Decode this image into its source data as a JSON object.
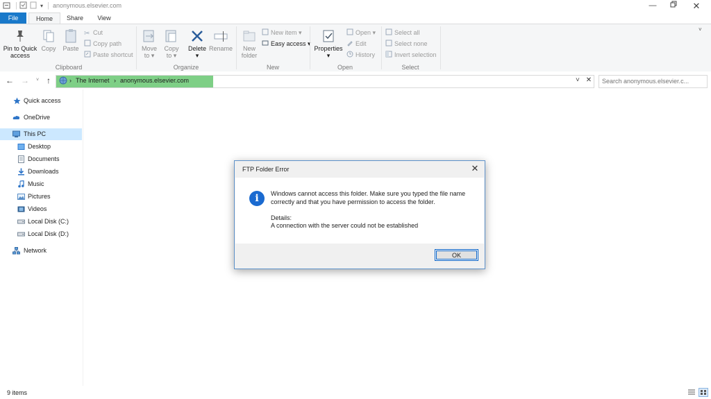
{
  "window": {
    "title": "anonymous.elsevier.com"
  },
  "tabs": [
    "File",
    "Home",
    "Share",
    "View"
  ],
  "ribbon": {
    "clipboard": {
      "pin_label_1": "Pin to Quick",
      "pin_label_2": "access",
      "copy": "Copy",
      "paste": "Paste",
      "cut": "Cut",
      "copy_path": "Copy path",
      "paste_shortcut": "Paste shortcut",
      "group": "Clipboard"
    },
    "organize": {
      "move_1": "Move",
      "move_2": "to",
      "copy_1": "Copy",
      "copy_2": "to",
      "delete": "Delete",
      "rename": "Rename",
      "group": "Organize"
    },
    "new": {
      "folder_1": "New",
      "folder_2": "folder",
      "new_item": "New item",
      "easy_access": "Easy access",
      "group": "New"
    },
    "open": {
      "properties": "Properties",
      "open": "Open",
      "edit": "Edit",
      "history": "History",
      "group": "Open"
    },
    "select": {
      "select_all": "Select all",
      "select_none": "Select none",
      "invert": "Invert selection",
      "group": "Select"
    }
  },
  "address": {
    "crumb1": "The Internet",
    "crumb2": "anonymous.elsevier.com"
  },
  "search": {
    "placeholder": "Search anonymous.elsevier.c..."
  },
  "nav": {
    "quick_access": "Quick access",
    "onedrive": "OneDrive",
    "this_pc": "This PC",
    "desktop": "Desktop",
    "documents": "Documents",
    "downloads": "Downloads",
    "music": "Music",
    "pictures": "Pictures",
    "videos": "Videos",
    "local_c": "Local Disk (C:)",
    "local_d": "Local Disk (D:)",
    "network": "Network"
  },
  "status": {
    "items": "9 items"
  },
  "dialog": {
    "title": "FTP Folder Error",
    "line1": "Windows cannot access this folder. Make sure you typed the file name",
    "line2": "correctly and that you have permission to access the folder.",
    "details_label": "Details:",
    "details": "A connection with the server could not be established",
    "ok": "OK"
  },
  "colors": {
    "accent": "#1979ca",
    "address_highlight": "#7ecf86",
    "selection": "#cce8ff",
    "info_icon": "#1a6ad0"
  }
}
